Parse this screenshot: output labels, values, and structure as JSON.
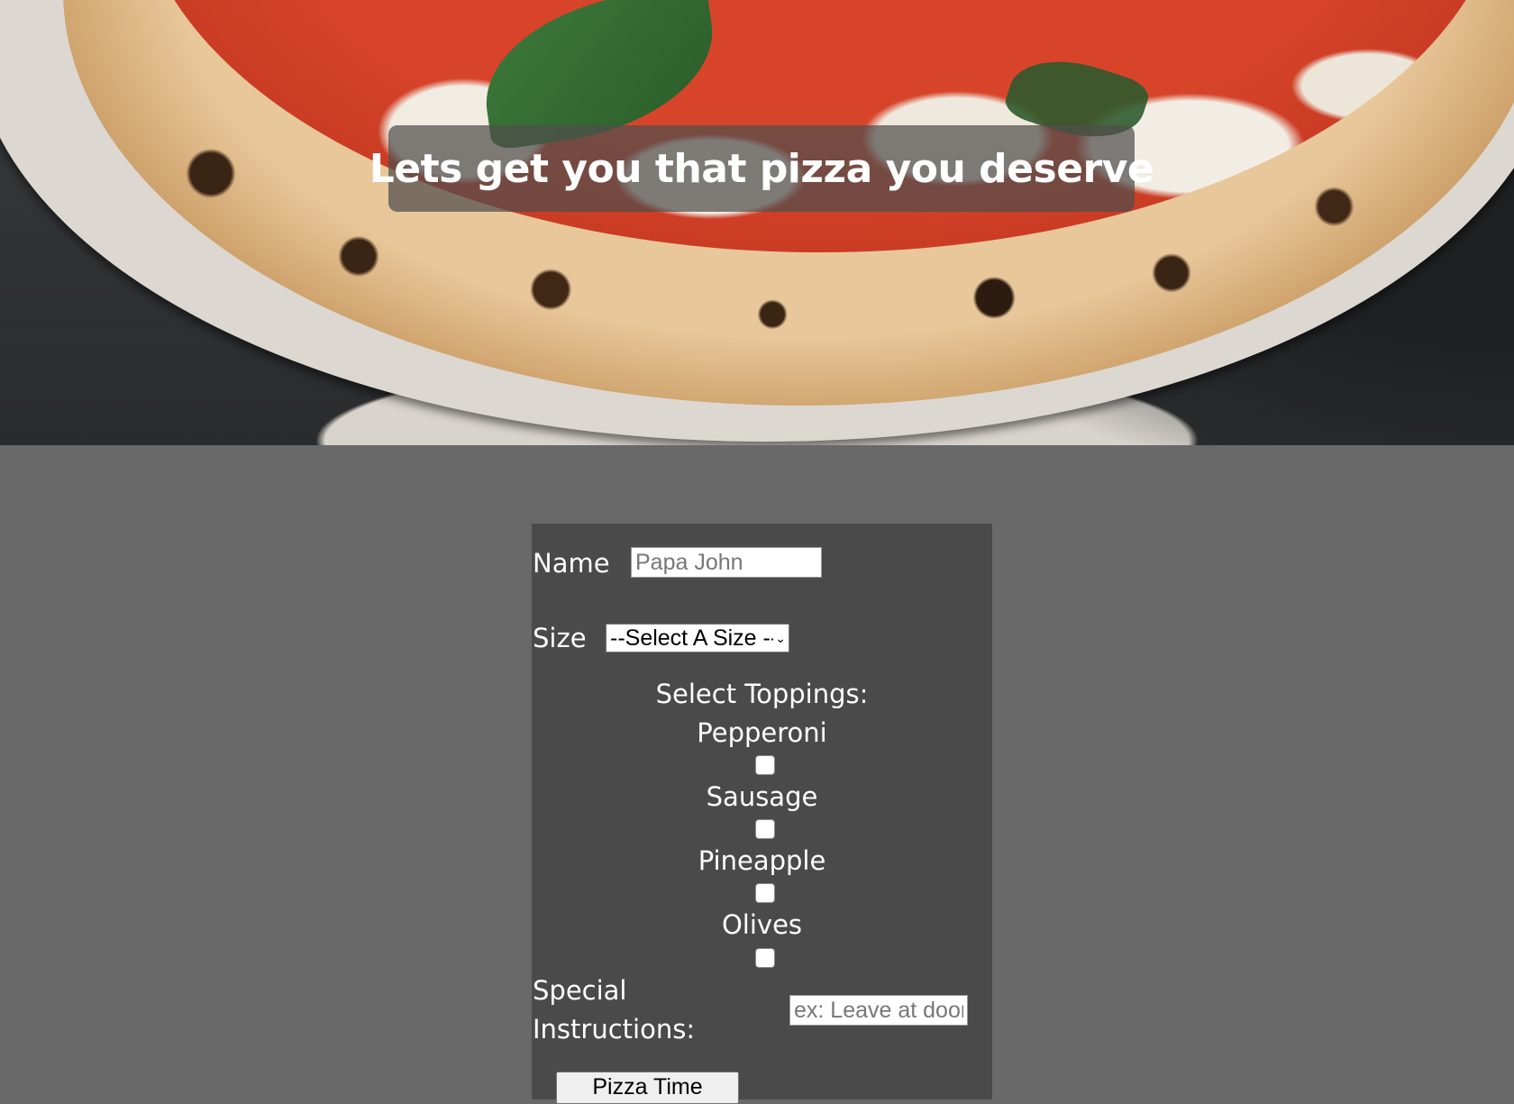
{
  "hero": {
    "image_description_icon": "pizza-photo",
    "banner_text": "Lets get you that pizza you deserve"
  },
  "form": {
    "name_label": "Name",
    "name_placeholder": "Papa John",
    "size_label": "Size",
    "size_selected": "--Select A Size --",
    "toppings_heading": "Select Toppings:",
    "toppings": [
      {
        "label": "Pepperoni",
        "checked": false
      },
      {
        "label": "Sausage",
        "checked": false
      },
      {
        "label": "Pineapple",
        "checked": false
      },
      {
        "label": "Olives",
        "checked": false
      }
    ],
    "special_label_line1": "Special",
    "special_label_line2": "Instructions:",
    "special_placeholder": "ex: Leave at door",
    "submit_label": "Pizza Time"
  },
  "colors": {
    "page_background": "#696969",
    "form_background": "#4a4a4a",
    "banner_background": "rgba(80,78,76,0.72)",
    "text": "#ffffff"
  }
}
